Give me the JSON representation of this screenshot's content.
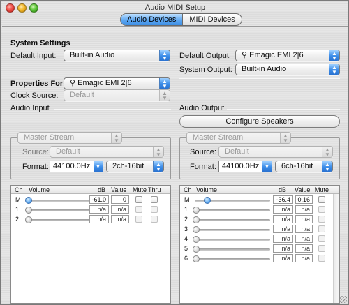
{
  "window": {
    "title": "Audio MIDI Setup"
  },
  "tabs": [
    {
      "label": "Audio Devices",
      "active": true
    },
    {
      "label": "MIDI Devices",
      "active": false
    }
  ],
  "system_settings": {
    "heading": "System Settings",
    "default_input_label": "Default Input:",
    "default_input_value": "Built-in Audio",
    "default_output_label": "Default Output:",
    "default_output_value": "Emagic EMI 2|6",
    "system_output_label": "System Output:",
    "system_output_value": "Built-in Audio"
  },
  "properties": {
    "label": "Properties For:",
    "value": "Emagic EMI 2|6",
    "clock_source_label": "Clock Source:",
    "clock_source_value": "Default"
  },
  "audio_input": {
    "heading": "Audio Input",
    "stream": "Master Stream",
    "source_label": "Source:",
    "source_value": "Default",
    "format_label": "Format:",
    "format_rate": "44100.0Hz",
    "format_bits": "2ch-16bit",
    "columns": {
      "ch": "Ch",
      "volume": "Volume",
      "db": "dB",
      "value": "Value",
      "mute": "Mute",
      "thru": "Thru"
    },
    "channels": [
      {
        "ch": "M",
        "db": "-61.0",
        "value": "0",
        "level": 0.0,
        "active": true
      },
      {
        "ch": "1",
        "db": "n/a",
        "value": "n/a",
        "level": 0.0,
        "active": false
      },
      {
        "ch": "2",
        "db": "n/a",
        "value": "n/a",
        "level": 0.0,
        "active": false
      }
    ]
  },
  "audio_output": {
    "heading": "Audio Output",
    "configure_button": "Configure Speakers",
    "stream": "Master Stream",
    "source_label": "Source:",
    "source_value": "Default",
    "format_label": "Format:",
    "format_rate": "44100.0Hz",
    "format_bits": "6ch-16bit",
    "columns": {
      "ch": "Ch",
      "volume": "Volume",
      "db": "dB",
      "value": "Value",
      "mute": "Mute"
    },
    "channels": [
      {
        "ch": "M",
        "db": "-36.4",
        "value": "0.16",
        "level": 0.16,
        "active": true
      },
      {
        "ch": "1",
        "db": "n/a",
        "value": "n/a",
        "level": 0.0,
        "active": false
      },
      {
        "ch": "2",
        "db": "n/a",
        "value": "n/a",
        "level": 0.0,
        "active": false
      },
      {
        "ch": "3",
        "db": "n/a",
        "value": "n/a",
        "level": 0.0,
        "active": false
      },
      {
        "ch": "4",
        "db": "n/a",
        "value": "n/a",
        "level": 0.0,
        "active": false
      },
      {
        "ch": "5",
        "db": "n/a",
        "value": "n/a",
        "level": 0.0,
        "active": false
      },
      {
        "ch": "6",
        "db": "n/a",
        "value": "n/a",
        "level": 0.0,
        "active": false
      }
    ]
  }
}
